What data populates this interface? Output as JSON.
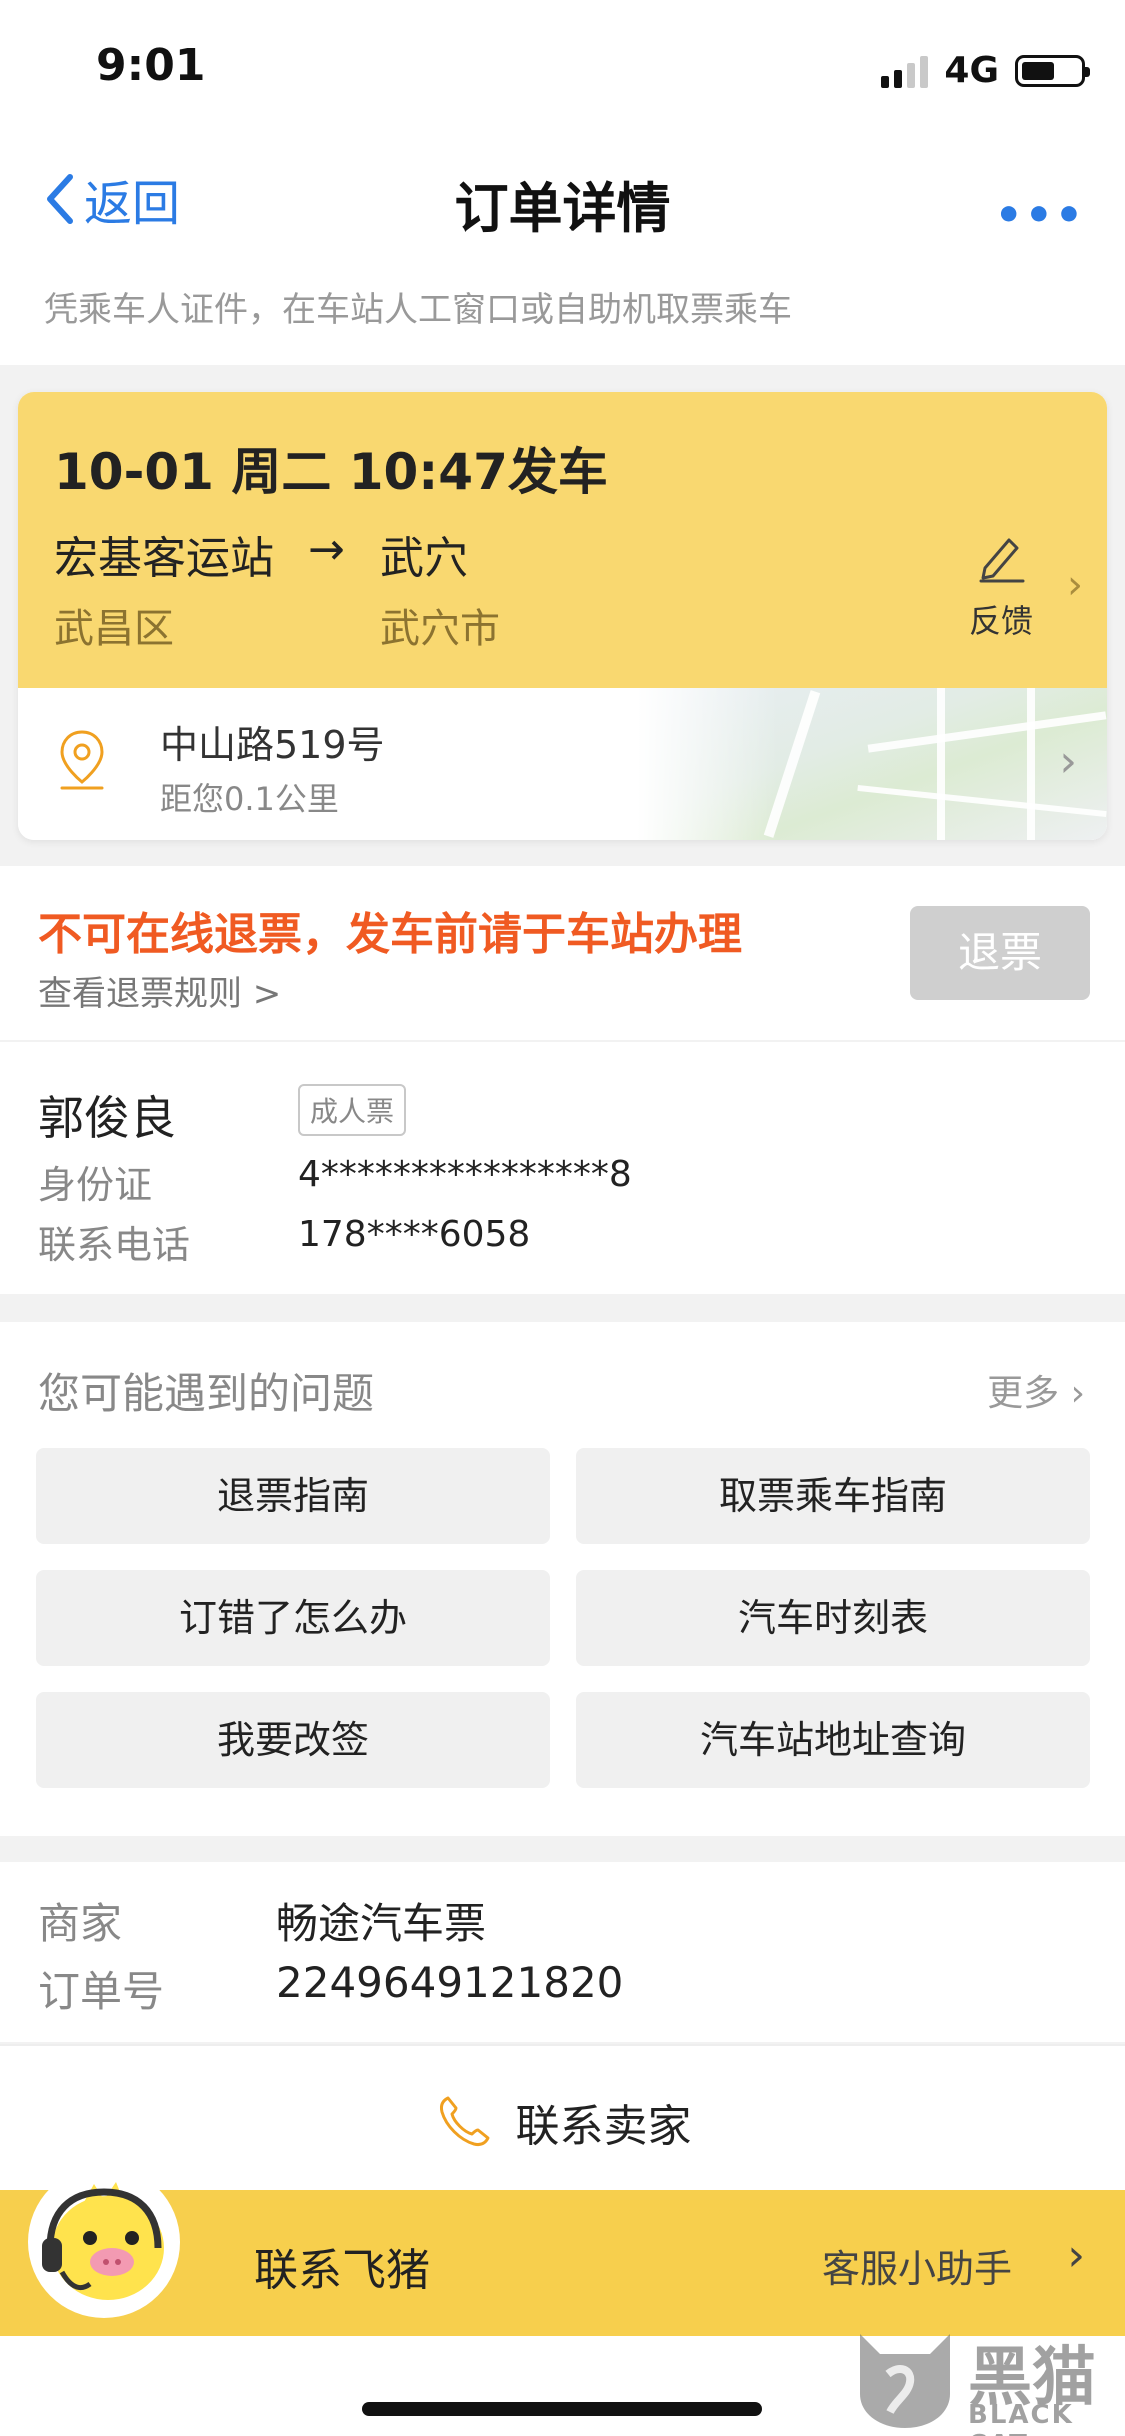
{
  "status_bar": {
    "time": "9:01",
    "network": "4G"
  },
  "nav": {
    "back_label": "返回",
    "title": "订单详情",
    "more_label": "•••"
  },
  "tip": "凭乘车人证件，在车站人工窗口或自助机取票乘车",
  "trip": {
    "departure": "10-01 周二 10:47发车",
    "from_station": "宏基客运站",
    "arrow": "→",
    "to_station": "武穴",
    "from_area": "武昌区",
    "to_area": "武穴市",
    "feedback_label": "反馈",
    "address": "中山路519号",
    "distance": "距您0.1公里"
  },
  "refund": {
    "warning": "不可在线退票，发车前请于车站办理",
    "rule_link": "查看退票规则 >",
    "button": "退票"
  },
  "passenger": {
    "name": "郭俊良",
    "ticket_type": "成人票",
    "id_label": "身份证",
    "id_value": "4****************8",
    "phone_label": "联系电话",
    "phone_value": "178****6058"
  },
  "faq": {
    "title": "您可能遇到的问题",
    "more": "更多 ›",
    "items": [
      "退票指南",
      "取票乘车指南",
      "订错了怎么办",
      "汽车时刻表",
      "我要改签",
      "汽车站地址查询"
    ]
  },
  "merchant": {
    "label": "商家",
    "value": "畅途汽车票",
    "order_label": "订单号",
    "order_value": "2249649121820",
    "contact_label": "联系卖家"
  },
  "fliggy": {
    "label": "联系飞猪",
    "help": "客服小助手",
    "chevron": "›"
  },
  "watermark": {
    "big": "黑猫",
    "small": "BLACK CAT"
  },
  "colors": {
    "accent_blue": "#2b7be4",
    "card_yellow": "#f9d870",
    "warning_orange": "#f05a22",
    "fliggy_yellow": "#f7cf4d"
  }
}
